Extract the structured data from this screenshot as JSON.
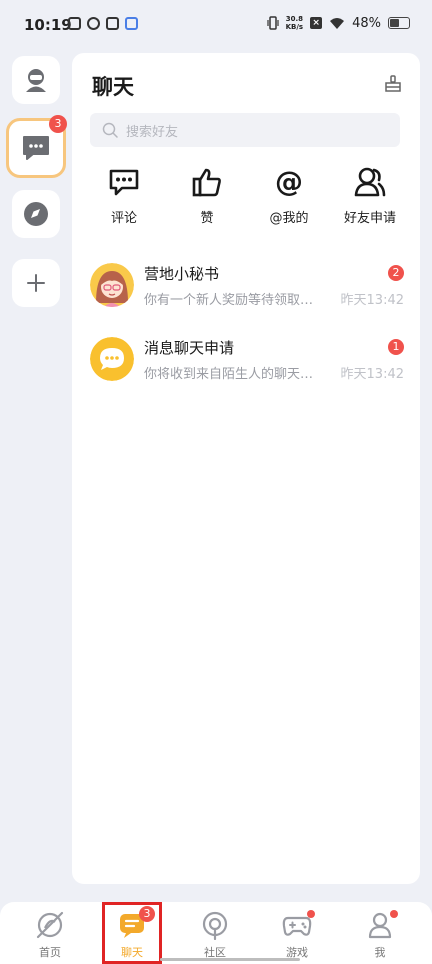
{
  "status_bar": {
    "time": "10:19",
    "net_speed_value": "30.8",
    "net_speed_unit": "KB/s",
    "battery": "48%"
  },
  "rail": {
    "chat_badge": "3"
  },
  "panel": {
    "title": "聊天",
    "search_placeholder": "搜索好友",
    "quick_actions": [
      {
        "label": "评论",
        "icon": "comment-icon"
      },
      {
        "label": "赞",
        "icon": "thumbs-up-icon"
      },
      {
        "label": "@我的",
        "icon": "at-icon"
      },
      {
        "label": "好友申请",
        "icon": "friend-request-icon"
      }
    ],
    "chats": [
      {
        "name": "营地小秘书",
        "preview": "你有一个新人奖励等待领取，快来看看吧",
        "time": "昨天13:42",
        "badge": "2"
      },
      {
        "name": "消息聊天申请",
        "preview": "你将收到来自陌生人的聊天申请消息",
        "time": "昨天13:42",
        "badge": "1"
      }
    ]
  },
  "bottom_nav": {
    "items": [
      {
        "label": "首页",
        "icon": "home-icon"
      },
      {
        "label": "聊天",
        "icon": "chat-icon",
        "badge": "3"
      },
      {
        "label": "社区",
        "icon": "community-icon"
      },
      {
        "label": "游戏",
        "icon": "gamepad-icon"
      },
      {
        "label": "我",
        "icon": "profile-icon"
      }
    ]
  },
  "colors": {
    "accent": "#f3a92b",
    "badge": "#f0524c",
    "highlight": "#e02424"
  }
}
